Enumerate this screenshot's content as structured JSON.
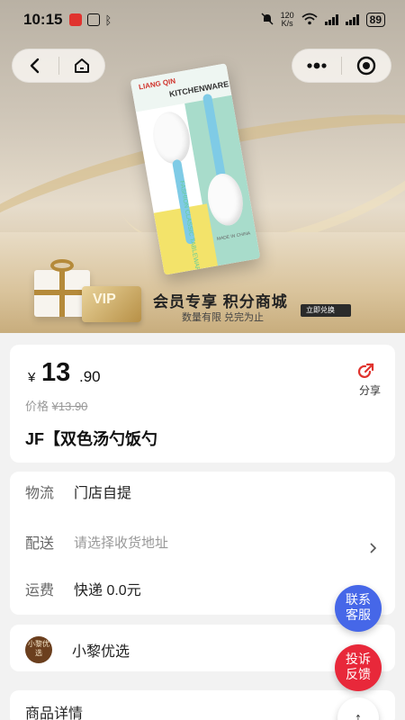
{
  "status_bar": {
    "time": "10:15",
    "speed_value": "120",
    "speed_unit": "K/s",
    "battery": "89"
  },
  "hero": {
    "package_brand": "LIANG QIN",
    "package_line": "KITCHENWARE",
    "package_side": "FASHION CLASSIC TABLEWARE",
    "package_made": "MADE IN CHINA",
    "vip_text": "VIP",
    "promo_title": "会员专享 积分商城",
    "promo_sub": "数量有限 兑完为止",
    "redeem_label": "立即兑换"
  },
  "price": {
    "currency": "¥",
    "integer": "13",
    "decimal": ".90",
    "original_label": "价格",
    "original_price": "¥13.90",
    "share_label": "分享"
  },
  "product": {
    "title": "JF【双色汤勺饭勺"
  },
  "shipping": {
    "logistics_key": "物流",
    "logistics_value": "门店自提",
    "delivery_key": "配送",
    "delivery_placeholder": "请选择收货地址",
    "fee_key": "运费",
    "fee_value": "快递 0.0元"
  },
  "store": {
    "logo_text": "小黎优选",
    "name": "小黎优选"
  },
  "details": {
    "title": "商品详情"
  },
  "floating": {
    "contact_line1": "联系",
    "contact_line2": "客服",
    "complain_line1": "投诉",
    "complain_line2": "反馈",
    "top_icon": "↑"
  },
  "colors": {
    "contact_bg": "#4667e8",
    "complain_bg": "#e8283a",
    "share_icon": "#e0332e"
  }
}
